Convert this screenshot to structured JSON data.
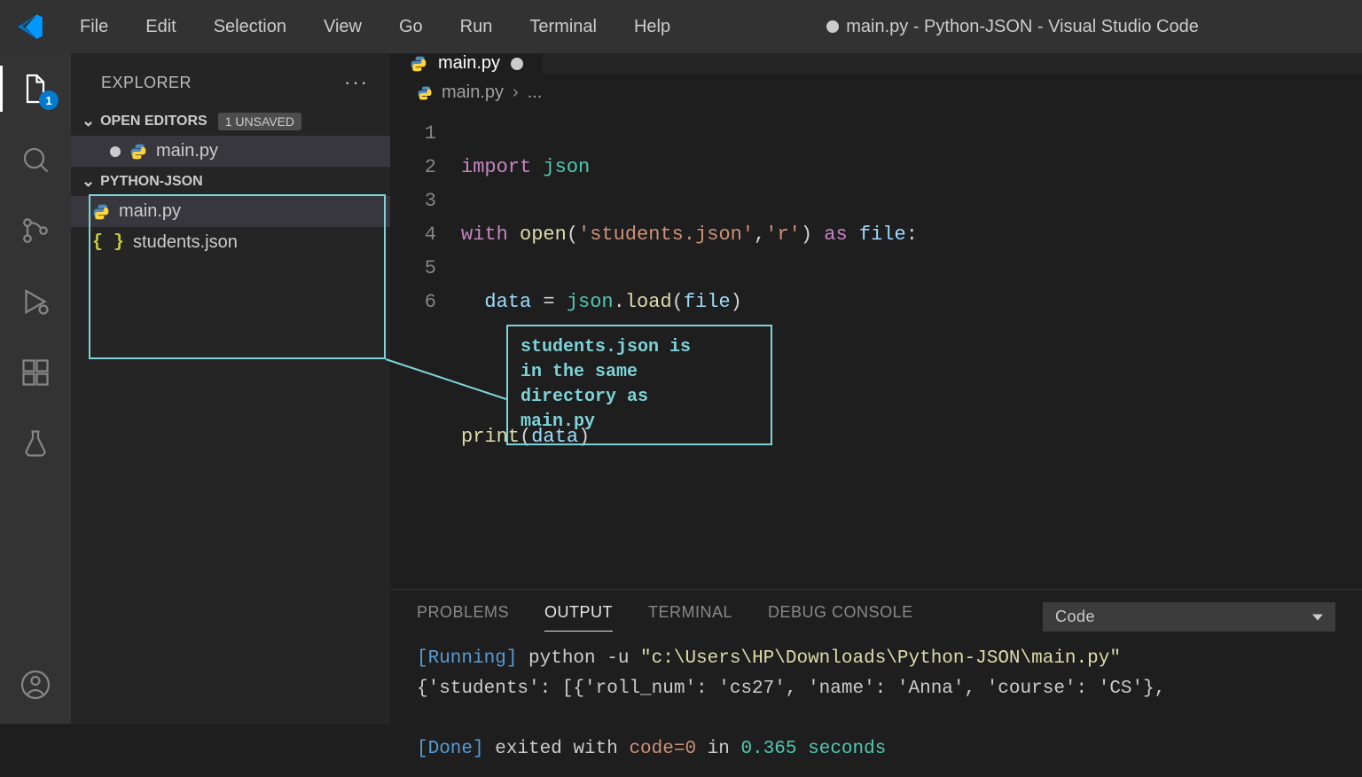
{
  "menubar": {
    "items": [
      "File",
      "Edit",
      "Selection",
      "View",
      "Go",
      "Run",
      "Terminal",
      "Help"
    ]
  },
  "window_title": "main.py - Python-JSON - Visual Studio Code",
  "activitybar": {
    "badge": "1"
  },
  "sidebar": {
    "title": "EXPLORER",
    "open_editors_label": "OPEN EDITORS",
    "unsaved_label": "1 UNSAVED",
    "open_editors": [
      {
        "name": "main.py",
        "icon": "python",
        "modified": true
      }
    ],
    "folder_label": "PYTHON-JSON",
    "files": [
      {
        "name": "main.py",
        "icon": "python",
        "selected": true
      },
      {
        "name": "students.json",
        "icon": "json",
        "selected": false
      }
    ]
  },
  "tab": {
    "name": "main.py",
    "modified": true
  },
  "breadcrumb": {
    "file": "main.py",
    "tail": "..."
  },
  "code": {
    "line_count": 6,
    "l1_kw": "import",
    "l1_mod": "json",
    "l2_kw1": "with",
    "l2_fn": "open",
    "l2_str1": "'students.json'",
    "l2_str2": "'r'",
    "l2_kw2": "as",
    "l2_var": "file",
    "l3_var1": "data",
    "l3_mod": "json",
    "l3_fn": "load",
    "l3_var2": "file",
    "l5_fn": "print",
    "l5_var": "data"
  },
  "annotation": "students.json is\nin the same\ndirectory as\nmain.py",
  "panel": {
    "tabs": [
      "PROBLEMS",
      "OUTPUT",
      "TERMINAL",
      "DEBUG CONSOLE"
    ],
    "active_tab": "OUTPUT",
    "dropdown": "Code",
    "running_label": "[Running]",
    "running_cmd": " python -u ",
    "running_path": "\"c:\\Users\\HP\\Downloads\\Python-JSON\\main.py\"",
    "output_line": "{'students': [{'roll_num': 'cs27', 'name': 'Anna', 'course': 'CS'},",
    "done_label": "[Done]",
    "done_text1": " exited with ",
    "done_code": "code=0",
    "done_text2": " in ",
    "done_time": "0.365 seconds"
  }
}
